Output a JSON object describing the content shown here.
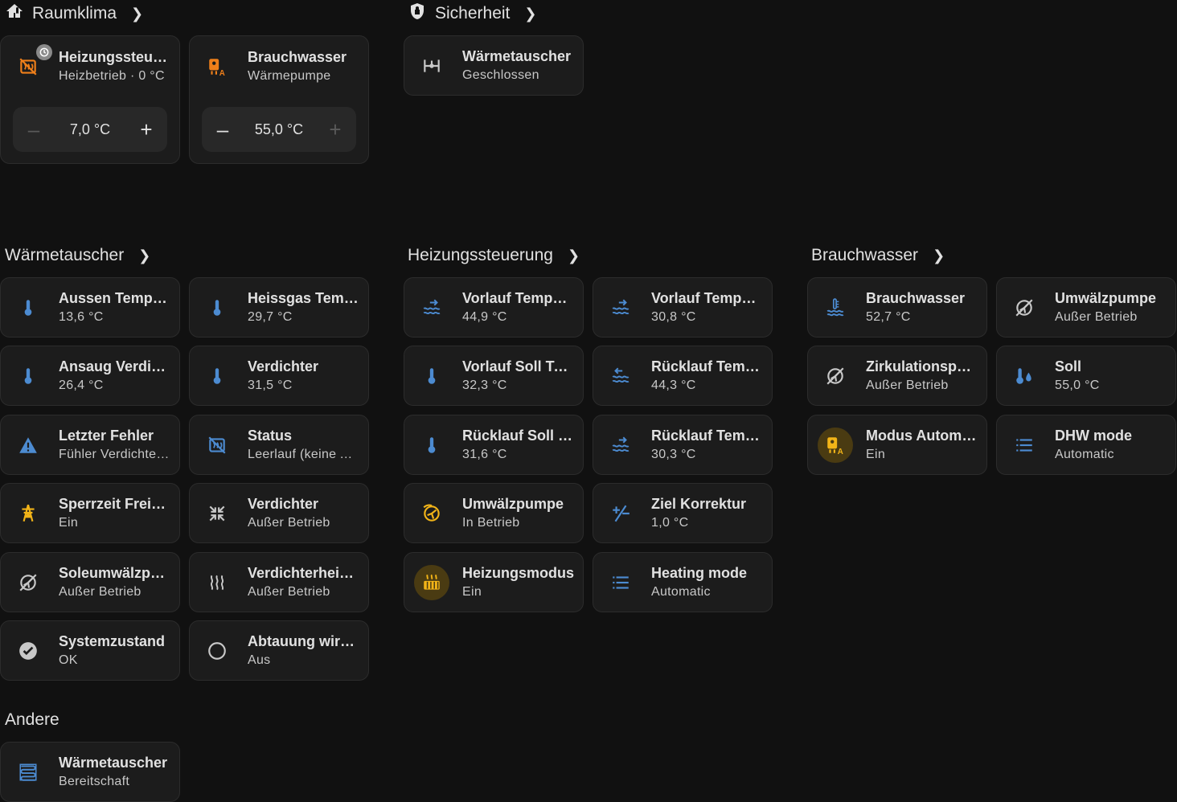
{
  "colors": {
    "background": "#111111",
    "card": "#1c1c1c",
    "icon_blue": "#4c8bd1",
    "icon_amber": "#f2b418",
    "icon_orange": "#ef7f1a",
    "icon_gray": "#c8c8c8"
  },
  "sections": {
    "raumklima": {
      "title": "Raumklima",
      "icon": "home-thermometer-icon"
    },
    "sicherheit": {
      "title": "Sicherheit",
      "icon": "shield-icon"
    },
    "waermetauscher": {
      "title": "Wärmetauscher"
    },
    "heizungssteuerung": {
      "title": "Heizungssteuerung"
    },
    "brauchwasser": {
      "title": "Brauchwasser"
    },
    "andere": {
      "title": "Andere"
    }
  },
  "raumklima": [
    {
      "name": "Heizungssteuerung",
      "state": "Heizbetrieb · 0 °C",
      "target": "7,0 °C",
      "icon": "heating-off-icon"
    },
    {
      "name": "Brauchwasser",
      "state": "Wärmepumpe",
      "target": "55,0 °C",
      "icon": "water-boiler-auto-icon"
    }
  ],
  "sicherheit": [
    {
      "name": "Wärmetauscher",
      "state": "Geschlossen",
      "icon": "valve-closed-icon"
    }
  ],
  "waermetauscher": [
    {
      "name": "Aussen Temperatur",
      "state": "13,6 °C",
      "icon": "thermometer-icon"
    },
    {
      "name": "Heissgas Temperatur",
      "state": "29,7 °C",
      "icon": "thermometer-icon"
    },
    {
      "name": "Ansaug Verdichter",
      "state": "26,4 °C",
      "icon": "thermometer-icon"
    },
    {
      "name": "Verdichter",
      "state": "31,5 °C",
      "icon": "thermometer-icon"
    },
    {
      "name": "Letzter Fehler",
      "state": "Fühler Verdichterheizung",
      "icon": "alert-icon"
    },
    {
      "name": "Status",
      "state": "Leerlauf (keine Anforderung)",
      "icon": "heating-off-icon"
    },
    {
      "name": "Sperrzeit Freigabe",
      "state": "Ein",
      "icon": "transmission-tower-icon"
    },
    {
      "name": "Verdichter",
      "state": "Außer Betrieb",
      "icon": "arrow-collapse-all-icon"
    },
    {
      "name": "Soleumwälzpumpe",
      "state": "Außer Betrieb",
      "icon": "pump-off-icon"
    },
    {
      "name": "Verdichterheizung",
      "state": "Außer Betrieb",
      "icon": "heat-wave-icon"
    },
    {
      "name": "Systemzustand",
      "state": "OK",
      "icon": "check-circle-icon"
    },
    {
      "name": "Abtauung wird durchgeführt",
      "state": "Aus",
      "icon": "circle-outline-icon"
    }
  ],
  "heizungssteuerung": [
    {
      "name": "Vorlauf Temperatur",
      "state": "44,9 °C",
      "icon": "flow-forward-icon"
    },
    {
      "name": "Vorlauf Temperatur",
      "state": "30,8 °C",
      "icon": "flow-forward-icon"
    },
    {
      "name": "Vorlauf Soll Temperatur",
      "state": "32,3 °C",
      "icon": "thermometer-icon"
    },
    {
      "name": "Rücklauf Temperatur",
      "state": "44,3 °C",
      "icon": "flow-return-icon"
    },
    {
      "name": "Rücklauf Soll Temperatur",
      "state": "31,6 °C",
      "icon": "thermometer-icon"
    },
    {
      "name": "Rücklauf Temperatur",
      "state": "30,3 °C",
      "icon": "flow-forward-icon"
    },
    {
      "name": "Umwälzpumpe",
      "state": "In Betrieb",
      "icon": "pump-icon"
    },
    {
      "name": "Ziel Korrektur",
      "state": "1,0 °C",
      "icon": "plus-minus-icon"
    },
    {
      "name": "Heizungsmodus",
      "state": "Ein",
      "icon": "radiator-icon"
    },
    {
      "name": "Heating mode",
      "state": "Automatic",
      "icon": "format-list-icon"
    }
  ],
  "brauchwasser": [
    {
      "name": "Brauchwasser",
      "state": "52,7 °C",
      "icon": "water-thermometer-icon"
    },
    {
      "name": "Umwälzpumpe",
      "state": "Außer Betrieb",
      "icon": "pump-off-icon"
    },
    {
      "name": "Zirkulationspumpe",
      "state": "Außer Betrieb",
      "icon": "pump-off-icon"
    },
    {
      "name": "Soll",
      "state": "55,0 °C",
      "icon": "water-thermometer-drop-icon"
    },
    {
      "name": "Modus Automatik",
      "state": "Ein",
      "icon": "water-boiler-auto-icon"
    },
    {
      "name": "DHW mode",
      "state": "Automatic",
      "icon": "format-list-icon"
    }
  ],
  "andere": [
    {
      "name": "Wärmetauscher",
      "state": "Bereitschaft",
      "icon": "heat-exchanger-icon"
    }
  ]
}
